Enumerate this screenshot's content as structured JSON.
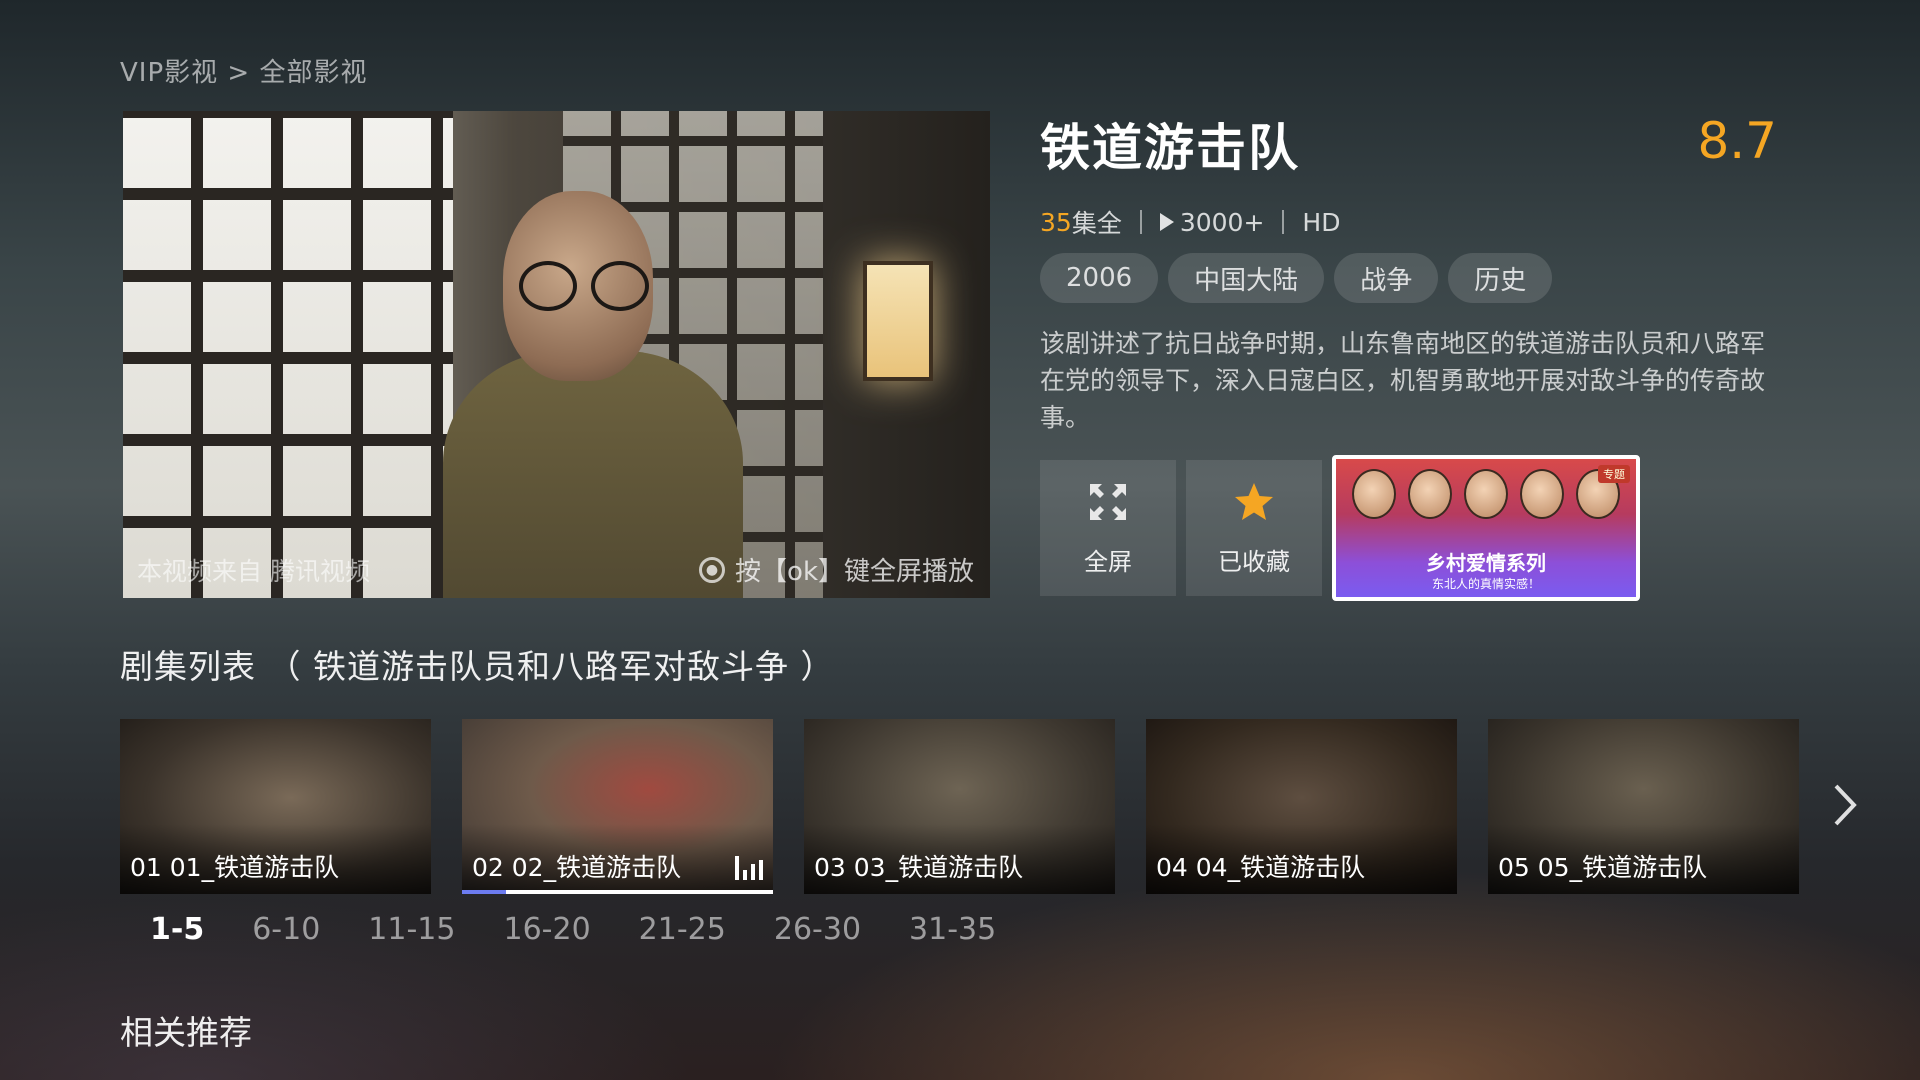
{
  "breadcrumb": "VIP影视 > 全部影视",
  "preview": {
    "source_text": "本视频来自 腾讯视频",
    "hint_text": "按【ok】键全屏播放"
  },
  "info": {
    "title": "铁道游击队",
    "rating": "8.7",
    "episode_count_num": "35",
    "episode_count_suffix": "集全",
    "plays": "3000+",
    "quality": "HD",
    "tags": [
      "2006",
      "中国大陆",
      "战争",
      "历史"
    ],
    "description": "该剧讲述了抗日战争时期，山东鲁南地区的铁道游击队员和八路军在党的领导下，深入日寇白区，机智勇敢地开展对敌斗争的传奇故事。"
  },
  "actions": {
    "fullscreen_label": "全屏",
    "favorite_label": "已收藏",
    "promo_badge": "专题",
    "promo_title": "乡村爱情系列",
    "promo_subtitle": "东北人的真情实感！"
  },
  "episodes": {
    "section_title": "剧集列表 （ 铁道游击队员和八路军对敌斗争 ）",
    "items": [
      {
        "label": "01 01_铁道游击队"
      },
      {
        "label": "02 02_铁道游击队",
        "playing": true,
        "progress": 0.14
      },
      {
        "label": "03 03_铁道游击队"
      },
      {
        "label": "04 04_铁道游击队"
      },
      {
        "label": "05 05_铁道游击队"
      }
    ],
    "pages": [
      "1-5",
      "6-10",
      "11-15",
      "16-20",
      "21-25",
      "26-30",
      "31-35"
    ],
    "active_page": "1-5"
  },
  "related_title": "相关推荐",
  "colors": {
    "accent": "#f5a623",
    "progress": "#6c7cf0"
  }
}
